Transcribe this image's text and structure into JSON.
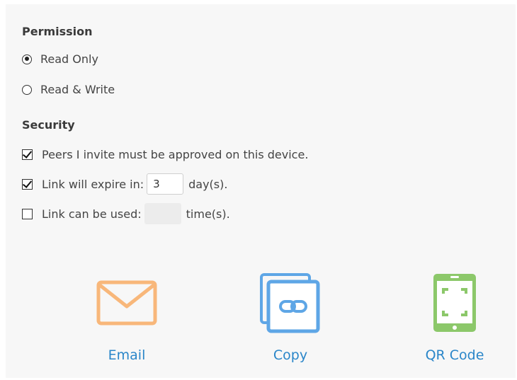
{
  "permission": {
    "title": "Permission",
    "options": [
      {
        "label": "Read Only",
        "selected": true
      },
      {
        "label": "Read & Write",
        "selected": false
      }
    ]
  },
  "security": {
    "title": "Security",
    "approve": {
      "label": "Peers I invite must be approved on this device.",
      "checked": true
    },
    "expire": {
      "label": "Link will expire in:",
      "value": "3",
      "unit": "day(s).",
      "checked": true
    },
    "uses": {
      "label": "Link can be used:",
      "value": "",
      "unit": "time(s).",
      "checked": false
    }
  },
  "share": {
    "email": {
      "label": "Email",
      "icon": "envelope-icon",
      "color": "#f8b77a"
    },
    "copy": {
      "label": "Copy",
      "icon": "copy-link-icon",
      "color": "#5ea6e6"
    },
    "qr": {
      "label": "QR Code",
      "icon": "qr-code-icon",
      "color": "#8cc86a"
    }
  },
  "colors": {
    "link": "#2a86c9",
    "panel": "#f7f7f7"
  }
}
